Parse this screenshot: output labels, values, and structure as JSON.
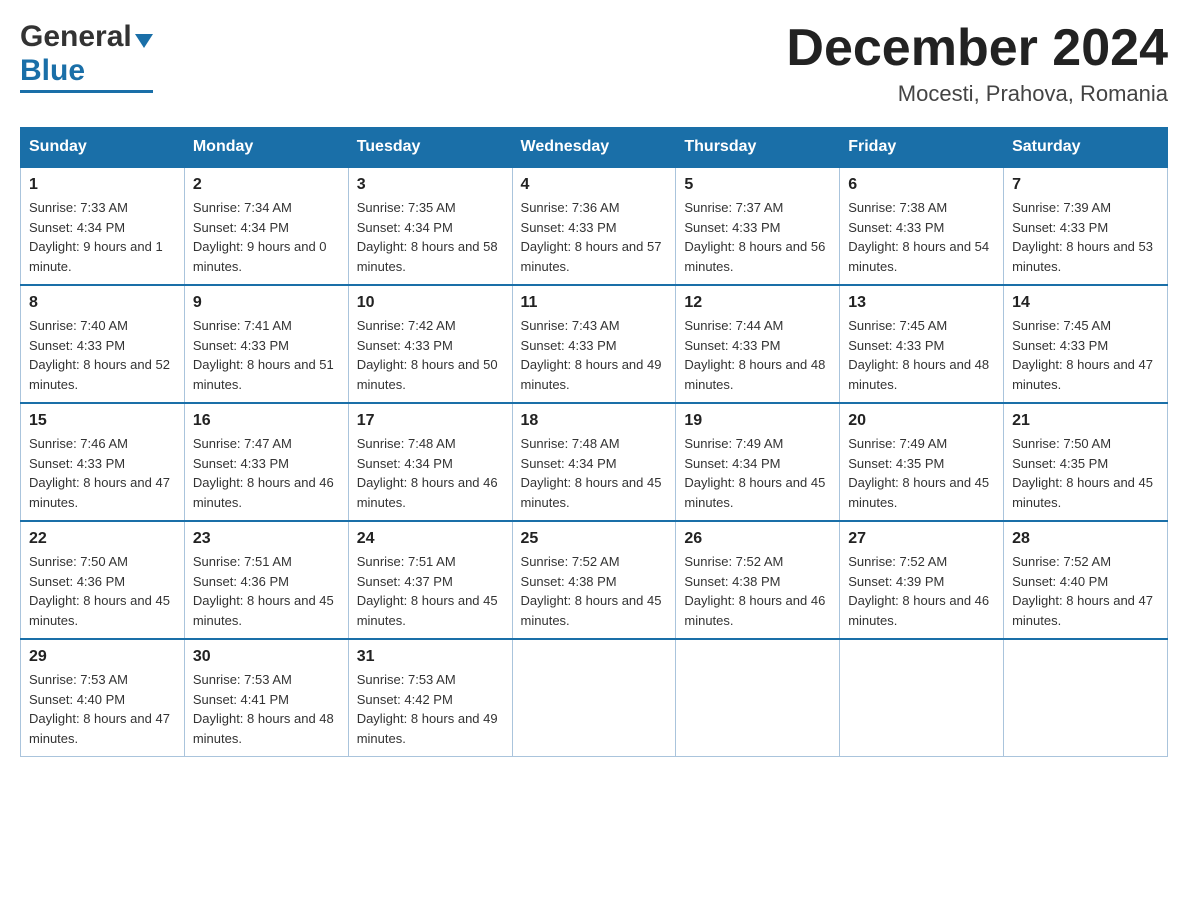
{
  "header": {
    "logo_general": "General",
    "logo_blue": "Blue",
    "month_title": "December 2024",
    "location": "Mocesti, Prahova, Romania"
  },
  "days_of_week": [
    "Sunday",
    "Monday",
    "Tuesday",
    "Wednesday",
    "Thursday",
    "Friday",
    "Saturday"
  ],
  "weeks": [
    [
      {
        "day": "1",
        "sunrise": "7:33 AM",
        "sunset": "4:34 PM",
        "daylight": "9 hours and 1 minute."
      },
      {
        "day": "2",
        "sunrise": "7:34 AM",
        "sunset": "4:34 PM",
        "daylight": "9 hours and 0 minutes."
      },
      {
        "day": "3",
        "sunrise": "7:35 AM",
        "sunset": "4:34 PM",
        "daylight": "8 hours and 58 minutes."
      },
      {
        "day": "4",
        "sunrise": "7:36 AM",
        "sunset": "4:33 PM",
        "daylight": "8 hours and 57 minutes."
      },
      {
        "day": "5",
        "sunrise": "7:37 AM",
        "sunset": "4:33 PM",
        "daylight": "8 hours and 56 minutes."
      },
      {
        "day": "6",
        "sunrise": "7:38 AM",
        "sunset": "4:33 PM",
        "daylight": "8 hours and 54 minutes."
      },
      {
        "day": "7",
        "sunrise": "7:39 AM",
        "sunset": "4:33 PM",
        "daylight": "8 hours and 53 minutes."
      }
    ],
    [
      {
        "day": "8",
        "sunrise": "7:40 AM",
        "sunset": "4:33 PM",
        "daylight": "8 hours and 52 minutes."
      },
      {
        "day": "9",
        "sunrise": "7:41 AM",
        "sunset": "4:33 PM",
        "daylight": "8 hours and 51 minutes."
      },
      {
        "day": "10",
        "sunrise": "7:42 AM",
        "sunset": "4:33 PM",
        "daylight": "8 hours and 50 minutes."
      },
      {
        "day": "11",
        "sunrise": "7:43 AM",
        "sunset": "4:33 PM",
        "daylight": "8 hours and 49 minutes."
      },
      {
        "day": "12",
        "sunrise": "7:44 AM",
        "sunset": "4:33 PM",
        "daylight": "8 hours and 48 minutes."
      },
      {
        "day": "13",
        "sunrise": "7:45 AM",
        "sunset": "4:33 PM",
        "daylight": "8 hours and 48 minutes."
      },
      {
        "day": "14",
        "sunrise": "7:45 AM",
        "sunset": "4:33 PM",
        "daylight": "8 hours and 47 minutes."
      }
    ],
    [
      {
        "day": "15",
        "sunrise": "7:46 AM",
        "sunset": "4:33 PM",
        "daylight": "8 hours and 47 minutes."
      },
      {
        "day": "16",
        "sunrise": "7:47 AM",
        "sunset": "4:33 PM",
        "daylight": "8 hours and 46 minutes."
      },
      {
        "day": "17",
        "sunrise": "7:48 AM",
        "sunset": "4:34 PM",
        "daylight": "8 hours and 46 minutes."
      },
      {
        "day": "18",
        "sunrise": "7:48 AM",
        "sunset": "4:34 PM",
        "daylight": "8 hours and 45 minutes."
      },
      {
        "day": "19",
        "sunrise": "7:49 AM",
        "sunset": "4:34 PM",
        "daylight": "8 hours and 45 minutes."
      },
      {
        "day": "20",
        "sunrise": "7:49 AM",
        "sunset": "4:35 PM",
        "daylight": "8 hours and 45 minutes."
      },
      {
        "day": "21",
        "sunrise": "7:50 AM",
        "sunset": "4:35 PM",
        "daylight": "8 hours and 45 minutes."
      }
    ],
    [
      {
        "day": "22",
        "sunrise": "7:50 AM",
        "sunset": "4:36 PM",
        "daylight": "8 hours and 45 minutes."
      },
      {
        "day": "23",
        "sunrise": "7:51 AM",
        "sunset": "4:36 PM",
        "daylight": "8 hours and 45 minutes."
      },
      {
        "day": "24",
        "sunrise": "7:51 AM",
        "sunset": "4:37 PM",
        "daylight": "8 hours and 45 minutes."
      },
      {
        "day": "25",
        "sunrise": "7:52 AM",
        "sunset": "4:38 PM",
        "daylight": "8 hours and 45 minutes."
      },
      {
        "day": "26",
        "sunrise": "7:52 AM",
        "sunset": "4:38 PM",
        "daylight": "8 hours and 46 minutes."
      },
      {
        "day": "27",
        "sunrise": "7:52 AM",
        "sunset": "4:39 PM",
        "daylight": "8 hours and 46 minutes."
      },
      {
        "day": "28",
        "sunrise": "7:52 AM",
        "sunset": "4:40 PM",
        "daylight": "8 hours and 47 minutes."
      }
    ],
    [
      {
        "day": "29",
        "sunrise": "7:53 AM",
        "sunset": "4:40 PM",
        "daylight": "8 hours and 47 minutes."
      },
      {
        "day": "30",
        "sunrise": "7:53 AM",
        "sunset": "4:41 PM",
        "daylight": "8 hours and 48 minutes."
      },
      {
        "day": "31",
        "sunrise": "7:53 AM",
        "sunset": "4:42 PM",
        "daylight": "8 hours and 49 minutes."
      },
      null,
      null,
      null,
      null
    ]
  ]
}
